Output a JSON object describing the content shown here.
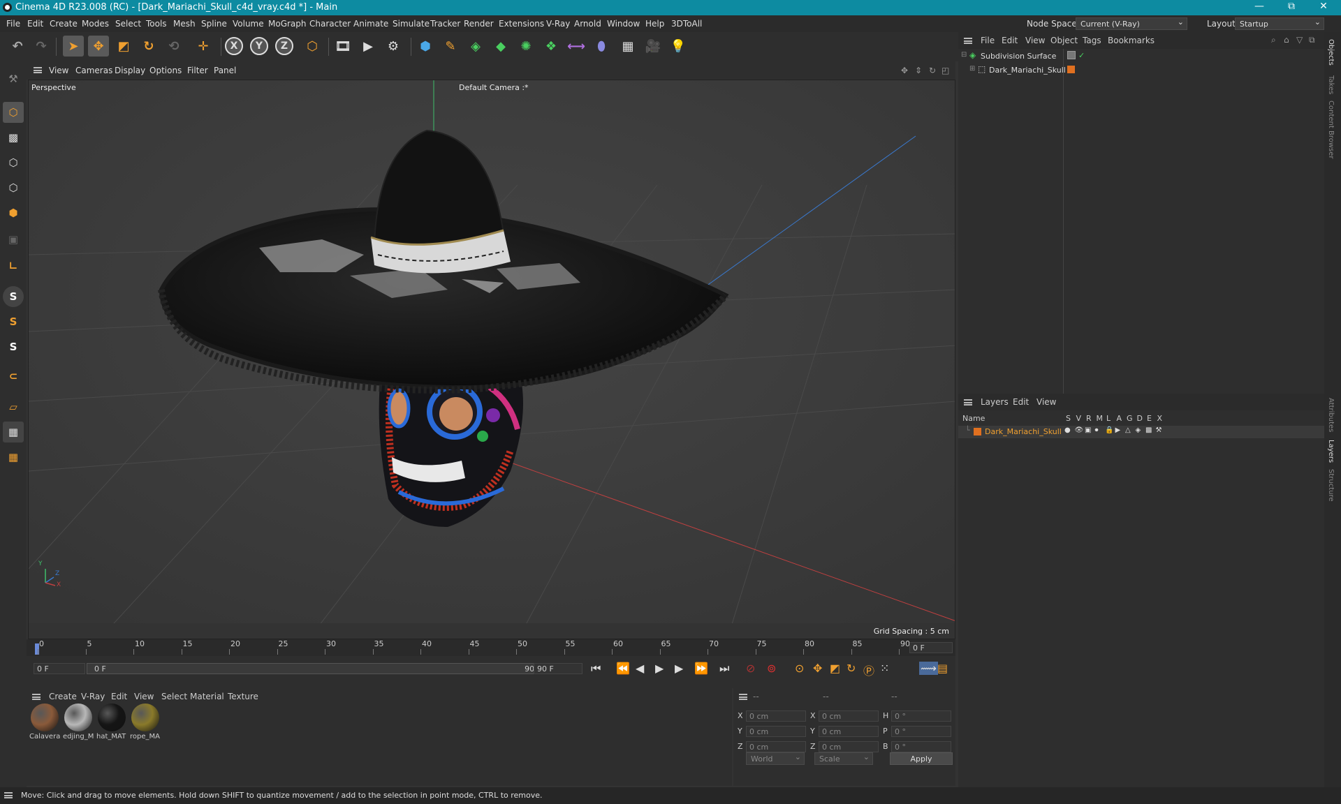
{
  "titlebar": {
    "title": "Cinema 4D R23.008 (RC) - [Dark_Mariachi_Skull_c4d_vray.c4d *] - Main",
    "minimize": "—",
    "maximize": "⧉",
    "close": "✕"
  },
  "menu": [
    "File",
    "Edit",
    "Create",
    "Modes",
    "Select",
    "Tools",
    "Mesh",
    "Spline",
    "Volume",
    "MoGraph",
    "Character",
    "Animate",
    "Simulate",
    "Tracker",
    "Render",
    "Extensions",
    "V-Ray",
    "Arnold",
    "Window",
    "Help",
    "3DToAll"
  ],
  "node_space": {
    "label": "Node Space:",
    "value": "Current (V-Ray)"
  },
  "layout": {
    "label": "Layout:",
    "value": "Startup"
  },
  "viewport_menu": [
    "View",
    "Cameras",
    "Display",
    "Options",
    "Filter",
    "Panel"
  ],
  "viewport": {
    "name": "Perspective",
    "camera": "Default Camera :*",
    "grid_spacing": "Grid Spacing : 5 cm",
    "axis_y": "Y",
    "axis_z": "Z",
    "axis_x": "X"
  },
  "timeline": {
    "ticks": [
      "0",
      "5",
      "10",
      "15",
      "20",
      "25",
      "30",
      "35",
      "40",
      "45",
      "50",
      "55",
      "60",
      "65",
      "70",
      "75",
      "80",
      "85",
      "90"
    ],
    "current_frame": "0 F",
    "start_field": "0 F",
    "range_start": "0 F",
    "range_end": "90 F",
    "end_field": "90 F"
  },
  "material_menu": [
    "Create",
    "V-Ray",
    "Edit",
    "View",
    "Select",
    "Material",
    "Texture"
  ],
  "materials": [
    {
      "name": "Calavera",
      "color": "#8a5a3a"
    },
    {
      "name": "edjing_M",
      "color": "#b8b8b8"
    },
    {
      "name": "hat_MAT",
      "color": "#151515"
    },
    {
      "name": "rope_MA",
      "color": "#8a7a2a"
    }
  ],
  "coords": {
    "headers": [
      "--",
      "--",
      "--"
    ],
    "rows": [
      {
        "a": "X",
        "av": "0 cm",
        "b": "X",
        "bv": "0 cm",
        "c": "H",
        "cv": "0 °"
      },
      {
        "a": "Y",
        "av": "0 cm",
        "b": "Y",
        "bv": "0 cm",
        "c": "P",
        "cv": "0 °"
      },
      {
        "a": "Z",
        "av": "0 cm",
        "b": "Z",
        "bv": "0 cm",
        "c": "B",
        "cv": "0 °"
      }
    ],
    "world": "World",
    "scale": "Scale",
    "apply": "Apply"
  },
  "object_menu": [
    "File",
    "Edit",
    "View",
    "Object",
    "Tags",
    "Bookmarks"
  ],
  "objects": [
    {
      "name": "Subdivision Surface"
    },
    {
      "name": "Dark_Mariachi_Skull"
    }
  ],
  "layers_menu": [
    "Layers",
    "Edit",
    "View"
  ],
  "layer_columns": {
    "name": "Name",
    "flags": [
      "S",
      "V",
      "R",
      "M",
      "L",
      "A",
      "G",
      "D",
      "E",
      "X"
    ]
  },
  "layers": [
    {
      "name": "Dark_Mariachi_Skull",
      "color": "#e07020"
    }
  ],
  "right_tabs": [
    "Objects",
    "Takes",
    "Content Browser",
    "Attributes",
    "Layers",
    "Structure"
  ],
  "status": "Move: Click and drag to move elements. Hold down SHIFT to quantize movement / add to the selection in point mode, CTRL to remove.",
  "colors": {
    "accent": "#0d8ba1",
    "orange": "#f0a030",
    "layer": "#e07020"
  }
}
